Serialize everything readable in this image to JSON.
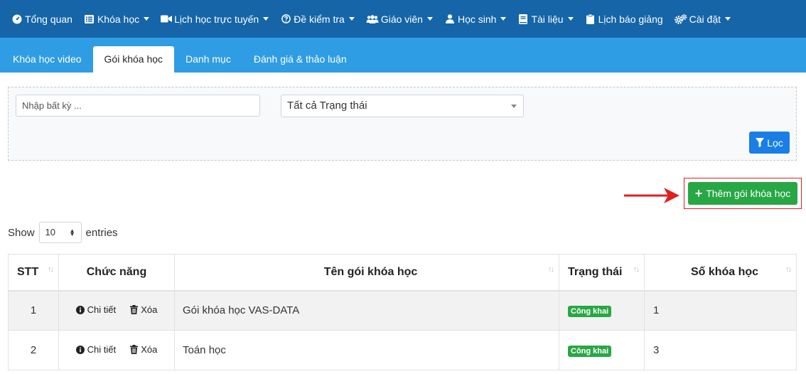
{
  "nav": [
    {
      "label": "Tổng quan",
      "icon": "dashboard-icon",
      "caret": false
    },
    {
      "label": "Khóa học",
      "icon": "list-icon",
      "caret": true
    },
    {
      "label": "Lịch học trực tuyến",
      "icon": "video-icon",
      "caret": true
    },
    {
      "label": "Đề kiểm tra",
      "icon": "question-circle-icon",
      "caret": true
    },
    {
      "label": "Giáo viên",
      "icon": "users-icon",
      "caret": true
    },
    {
      "label": "Học sinh",
      "icon": "user-icon",
      "caret": true
    },
    {
      "label": "Tài liệu",
      "icon": "book-icon",
      "caret": true
    },
    {
      "label": "Lịch báo giảng",
      "icon": "clipboard-icon",
      "caret": false
    },
    {
      "label": "Cài đặt",
      "icon": "cogs-icon",
      "caret": true
    }
  ],
  "tabs": [
    {
      "label": "Khóa học video",
      "active": false
    },
    {
      "label": "Gói khóa học",
      "active": true
    },
    {
      "label": "Danh mục",
      "active": false
    },
    {
      "label": "Đánh giá & thảo luận",
      "active": false
    }
  ],
  "filter": {
    "search_placeholder": "Nhập bất kỳ ...",
    "status_value": "Tất cả Trạng thái",
    "filter_label": "Lọc"
  },
  "add_button": {
    "label": "Thêm gói khóa học"
  },
  "length": {
    "show": "Show",
    "value": "10",
    "entries": "entries"
  },
  "table": {
    "headers": {
      "stt": "STT",
      "functions": "Chức năng",
      "name": "Tên gói khóa học",
      "status": "Trạng thái",
      "count": "Số khóa học"
    },
    "detail_label": "Chi tiết",
    "delete_label": "Xóa",
    "rows": [
      {
        "stt": "1",
        "name": "Gói khóa học VAS-DATA",
        "status": "Công khai",
        "count": "1"
      },
      {
        "stt": "2",
        "name": "Toán học",
        "status": "Công khai",
        "count": "3"
      }
    ]
  },
  "colors": {
    "topnav": "#1565a8",
    "subnav": "#2f9de3",
    "primary": "#1a7ee6",
    "success": "#28a745",
    "highlight": "#e01f1f"
  }
}
